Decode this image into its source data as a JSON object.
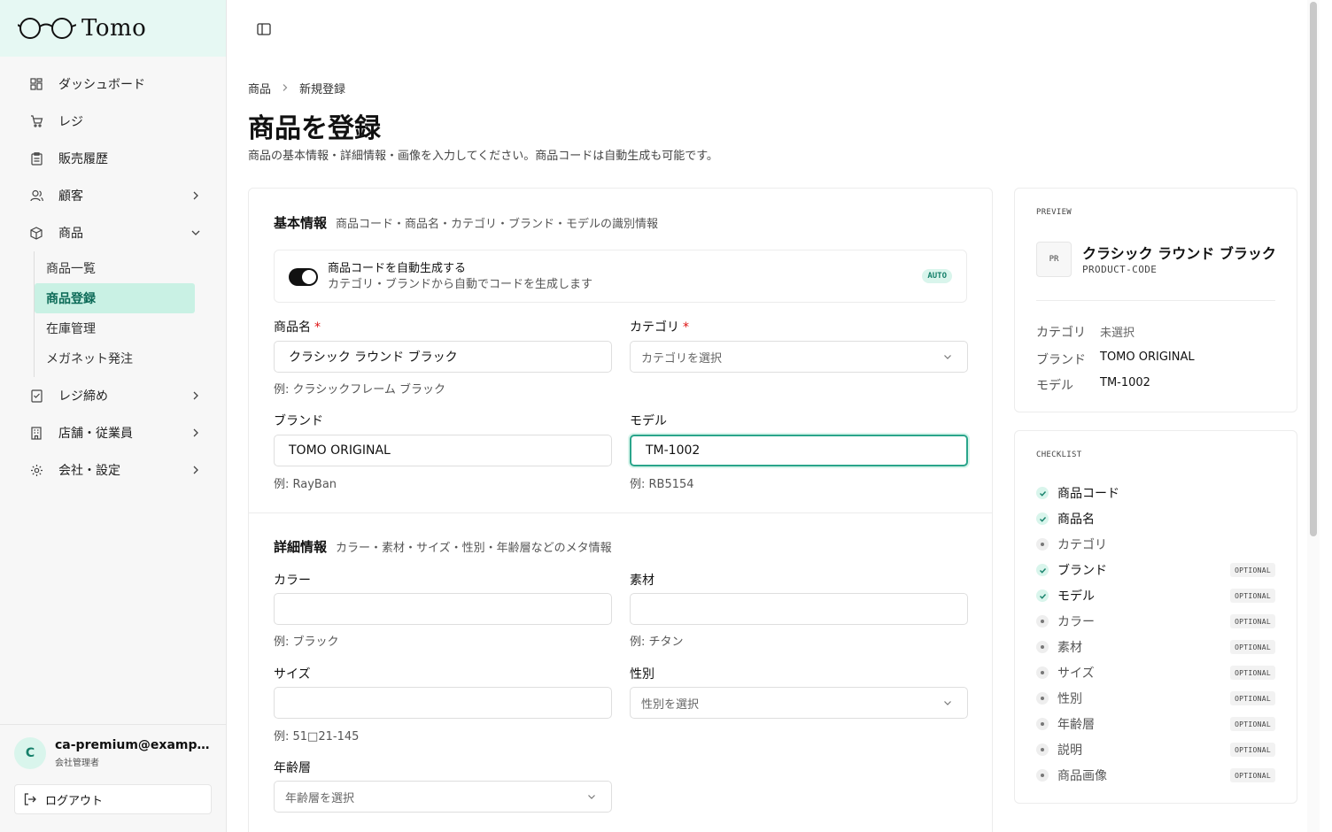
{
  "brand": {
    "name": "Tomo"
  },
  "sidebar": {
    "items": [
      {
        "label": "ダッシュボード",
        "icon": "dashboard-grid-icon",
        "expandable": false
      },
      {
        "label": "レジ",
        "icon": "cart-icon",
        "expandable": false
      },
      {
        "label": "販売履歴",
        "icon": "clipboard-icon",
        "expandable": false
      },
      {
        "label": "顧客",
        "icon": "users-icon",
        "expandable": true
      },
      {
        "label": "商品",
        "icon": "package-icon",
        "expandable": true,
        "expanded": true
      },
      {
        "label": "レジ締め",
        "icon": "checklist-icon",
        "expandable": true
      },
      {
        "label": "店舗・従業員",
        "icon": "building-icon",
        "expandable": true
      },
      {
        "label": "会社・設定",
        "icon": "gear-icon",
        "expandable": true
      }
    ],
    "sub_items": [
      {
        "label": "商品一覧",
        "active": false
      },
      {
        "label": "商品登録",
        "active": true
      },
      {
        "label": "在庫管理",
        "active": false
      },
      {
        "label": "メガネット発注",
        "active": false
      }
    ],
    "user": {
      "initial": "C",
      "email": "ca-premium@example.com",
      "role": "会社管理者"
    },
    "logout_label": "ログアウト"
  },
  "header": {
    "breadcrumb": [
      "商品",
      "新規登録"
    ],
    "title": "商品を登録",
    "description": "商品の基本情報・詳細情報・画像を入力してください。商品コードは自動生成も可能です。"
  },
  "basic": {
    "title": "基本情報",
    "subtitle": "商品コード・商品名・カテゴリ・ブランド・モデルの識別情報",
    "auto_code": {
      "title": "商品コードを自動生成する",
      "description": "カテゴリ・ブランドから自動でコードを生成します",
      "badge": "AUTO",
      "enabled": true
    },
    "name": {
      "label": "商品名",
      "value": "クラシック ラウンド ブラック",
      "hint": "例: クラシックフレーム ブラック",
      "required": true
    },
    "category": {
      "label": "カテゴリ",
      "placeholder": "カテゴリを選択",
      "required": true
    },
    "brand": {
      "label": "ブランド",
      "value": "TOMO ORIGINAL",
      "hint": "例: RayBan"
    },
    "model": {
      "label": "モデル",
      "value": "TM-1002",
      "hint": "例: RB5154"
    }
  },
  "detail": {
    "title": "詳細情報",
    "subtitle": "カラー・素材・サイズ・性別・年齢層などのメタ情報",
    "color": {
      "label": "カラー",
      "value": "",
      "hint": "例: ブラック"
    },
    "material": {
      "label": "素材",
      "value": "",
      "hint": "例: チタン"
    },
    "size": {
      "label": "サイズ",
      "value": "",
      "hint": "例: 51□21-145"
    },
    "gender": {
      "label": "性別",
      "placeholder": "性別を選択"
    },
    "age": {
      "label": "年齢層",
      "placeholder": "年齢層を選択"
    }
  },
  "preview": {
    "heading": "PREVIEW",
    "thumb": "PR",
    "name": "クラシック ラウンド ブラック",
    "code": "PRODUCT-CODE",
    "rows": [
      {
        "key": "カテゴリ",
        "value": "未選択",
        "muted": true
      },
      {
        "key": "ブランド",
        "value": "TOMO ORIGINAL",
        "muted": false
      },
      {
        "key": "モデル",
        "value": "TM-1002",
        "muted": false
      }
    ]
  },
  "checklist": {
    "heading": "CHECKLIST",
    "optional_label": "OPTIONAL",
    "items": [
      {
        "label": "商品コード",
        "done": true,
        "optional": false
      },
      {
        "label": "商品名",
        "done": true,
        "optional": false
      },
      {
        "label": "カテゴリ",
        "done": false,
        "optional": false
      },
      {
        "label": "ブランド",
        "done": true,
        "optional": true
      },
      {
        "label": "モデル",
        "done": true,
        "optional": true
      },
      {
        "label": "カラー",
        "done": false,
        "optional": true
      },
      {
        "label": "素材",
        "done": false,
        "optional": true
      },
      {
        "label": "サイズ",
        "done": false,
        "optional": true
      },
      {
        "label": "性別",
        "done": false,
        "optional": true
      },
      {
        "label": "年齢層",
        "done": false,
        "optional": true
      },
      {
        "label": "説明",
        "done": false,
        "optional": true
      },
      {
        "label": "商品画像",
        "done": false,
        "optional": true
      }
    ]
  },
  "colors": {
    "accent": "#2aa58b",
    "accent_light": "#d9f5ec",
    "active_bg": "#c9f1e4",
    "required": "#dd1111"
  }
}
